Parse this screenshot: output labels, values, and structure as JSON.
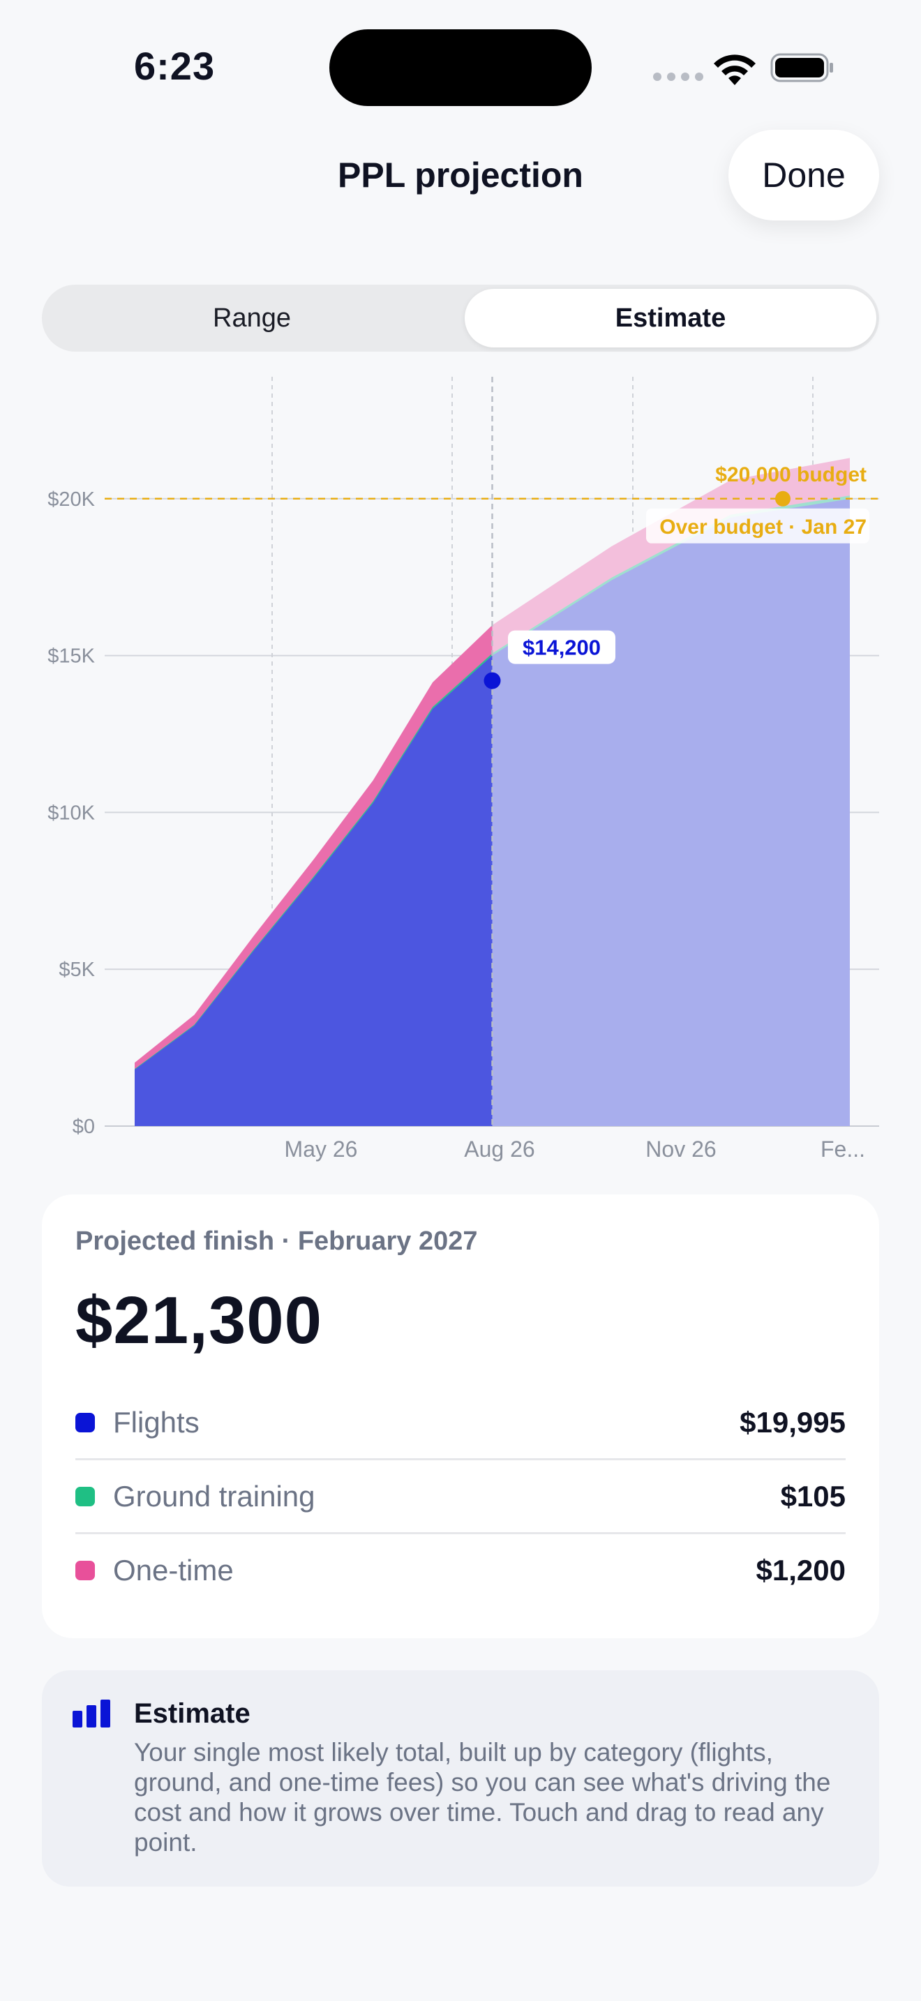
{
  "status_bar": {
    "time": "6:23"
  },
  "nav": {
    "title": "PPL projection",
    "done_label": "Done"
  },
  "segment": {
    "options": [
      "Range",
      "Estimate"
    ],
    "selected": "Estimate"
  },
  "colors": {
    "flights": "#0a14d6",
    "ground": "#1fbf84",
    "onetime": "#e8509a",
    "budget": "#e8ad12",
    "projection_fill": "#a8aeed",
    "actual_fill": "#4c56e0"
  },
  "chart_data": {
    "type": "area",
    "y_axis": {
      "ticks": [
        "$0",
        "$5K",
        "$10K",
        "$15K",
        "$20K"
      ],
      "ylim": [
        0,
        22000
      ]
    },
    "x_axis": {
      "ticks": [
        "May 26",
        "Aug 26",
        "Nov 26",
        "Fe..."
      ]
    },
    "series": [
      {
        "name": "Flights",
        "points": [
          [
            "Feb 26",
            1800
          ],
          [
            "Mar 26",
            3200
          ],
          [
            "Apr 26",
            5600
          ],
          [
            "May 26",
            7900
          ],
          [
            "Jun 26",
            10300
          ],
          [
            "Jul 26",
            13300
          ],
          [
            "Aug 26",
            15000
          ],
          [
            "Sep 26",
            16200
          ],
          [
            "Oct 26",
            17400
          ],
          [
            "Nov 26",
            18400
          ],
          [
            "Dec 26",
            19400
          ],
          [
            "Feb 27",
            19995
          ]
        ]
      },
      {
        "name": "Ground training",
        "points": [
          [
            "Feb 26",
            20
          ],
          [
            "Aug 26",
            70
          ],
          [
            "Feb 27",
            105
          ]
        ]
      },
      {
        "name": "One-time",
        "points": [
          [
            "Feb 26",
            200
          ],
          [
            "Aug 26",
            900
          ],
          [
            "Feb 27",
            1200
          ]
        ]
      }
    ],
    "actual_split": "Aug 26",
    "budget_line": {
      "value": 20000,
      "label": "$20,000 budget"
    },
    "over_budget_label": "Over budget · Jan 27",
    "marker": {
      "label": "$14,200",
      "value": 14200
    }
  },
  "summary": {
    "subtitle": "Projected finish · February 2027",
    "total": "$21,300",
    "rows": [
      {
        "label": "Flights",
        "value": "$19,995",
        "color": "#0a14d6"
      },
      {
        "label": "Ground training",
        "value": "$105",
        "color": "#1fbf84"
      },
      {
        "label": "One-time",
        "value": "$1,200",
        "color": "#e8509a"
      }
    ]
  },
  "info": {
    "icon": "bar-chart-icon",
    "title": "Estimate",
    "text": "Your single most likely total, built up by category (flights, ground, and one-time fees) so you can see what's driving the cost and how it grows over time. Touch and drag to read any point."
  }
}
